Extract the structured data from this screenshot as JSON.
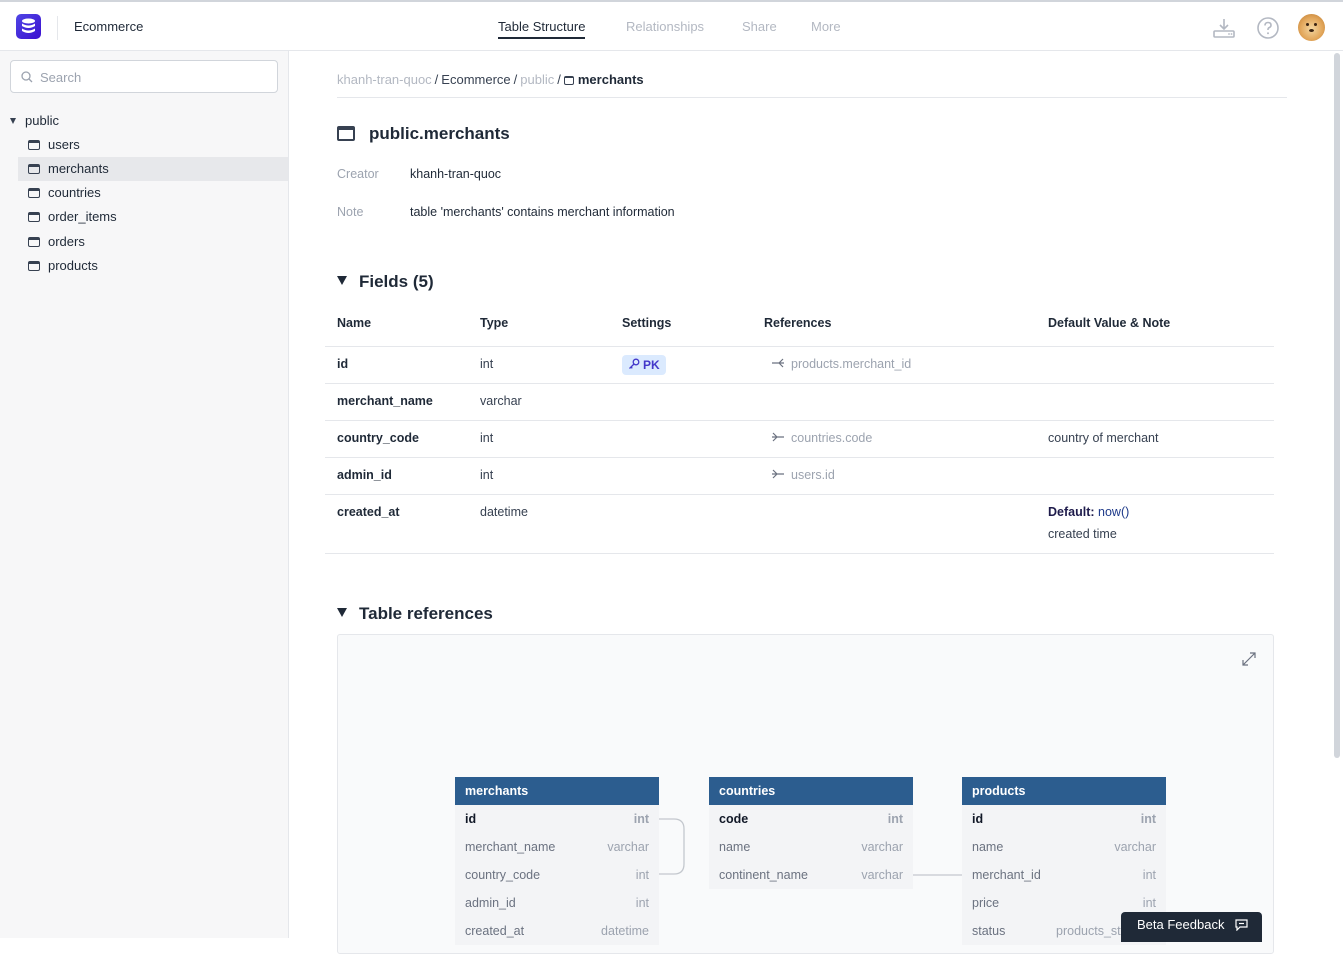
{
  "app": {
    "project_name": "Ecommerce",
    "tabs": [
      {
        "label": "Table Structure",
        "active": true
      },
      {
        "label": "Relationships",
        "active": false
      },
      {
        "label": "Share",
        "active": false
      },
      {
        "label": "More",
        "active": false
      }
    ],
    "icons": [
      "download-icon",
      "help-icon",
      "avatar"
    ]
  },
  "sidebar": {
    "search_placeholder": "Search",
    "schema": "public",
    "items": [
      {
        "label": "users",
        "selected": false
      },
      {
        "label": "merchants",
        "selected": true
      },
      {
        "label": "countries",
        "selected": false
      },
      {
        "label": "order_items",
        "selected": false
      },
      {
        "label": "orders",
        "selected": false
      },
      {
        "label": "products",
        "selected": false
      }
    ]
  },
  "breadcrumb": {
    "owner": "khanh-tran-quoc",
    "project": "Ecommerce",
    "schema": "public",
    "table": "merchants",
    "separator": "/"
  },
  "table": {
    "title": "public.merchants",
    "creator_label": "Creator",
    "creator_value": "khanh-tran-quoc",
    "note_label": "Note",
    "note_value": "table 'merchants' contains merchant information"
  },
  "fields": {
    "heading": "Fields (5)",
    "columns": [
      "Name",
      "Type",
      "Settings",
      "References",
      "Default Value & Note"
    ],
    "rows": [
      {
        "name": "id",
        "type": "int",
        "setting": "PK",
        "reference": "products.merchant_id",
        "default_label": "",
        "default_value": "",
        "note": ""
      },
      {
        "name": "merchant_name",
        "type": "varchar",
        "setting": "",
        "reference": "",
        "default_label": "",
        "default_value": "",
        "note": ""
      },
      {
        "name": "country_code",
        "type": "int",
        "setting": "",
        "reference": "countries.code",
        "default_label": "",
        "default_value": "",
        "note": "country of merchant"
      },
      {
        "name": "admin_id",
        "type": "int",
        "setting": "",
        "reference": "users.id",
        "default_label": "",
        "default_value": "",
        "note": ""
      },
      {
        "name": "created_at",
        "type": "datetime",
        "setting": "",
        "reference": "",
        "default_label": "Default:",
        "default_value": "now()",
        "note": "created time"
      }
    ]
  },
  "references": {
    "heading": "Table references",
    "tables": [
      {
        "name": "merchants",
        "columns": [
          {
            "name": "id",
            "type": "int",
            "key": true
          },
          {
            "name": "merchant_name",
            "type": "varchar",
            "key": false
          },
          {
            "name": "country_code",
            "type": "int",
            "key": false
          },
          {
            "name": "admin_id",
            "type": "int",
            "key": false
          },
          {
            "name": "created_at",
            "type": "datetime",
            "key": false
          }
        ]
      },
      {
        "name": "countries",
        "columns": [
          {
            "name": "code",
            "type": "int",
            "key": true
          },
          {
            "name": "name",
            "type": "varchar",
            "key": false
          },
          {
            "name": "continent_name",
            "type": "varchar",
            "key": false
          }
        ]
      },
      {
        "name": "products",
        "columns": [
          {
            "name": "id",
            "type": "int",
            "key": true
          },
          {
            "name": "name",
            "type": "varchar",
            "key": false
          },
          {
            "name": "merchant_id",
            "type": "int",
            "key": false
          },
          {
            "name": "price",
            "type": "int",
            "key": false
          },
          {
            "name": "status",
            "type": "products_st",
            "key": false
          }
        ]
      }
    ]
  },
  "feedback": {
    "label": "Beta Feedback"
  }
}
